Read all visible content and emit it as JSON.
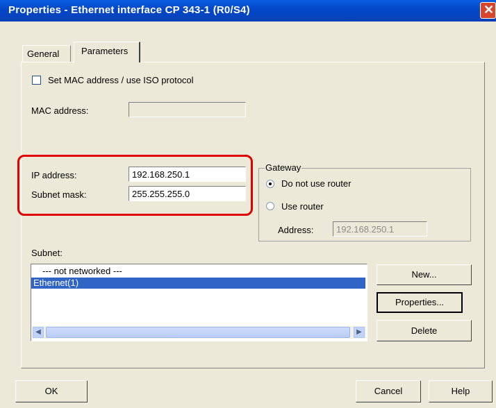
{
  "window": {
    "title": "Properties - Ethernet interface  CP 343-1 (R0/S4)"
  },
  "tabs": [
    {
      "label": "General"
    },
    {
      "label": "Parameters"
    }
  ],
  "mac": {
    "checkbox_label": "Set MAC address / use ISO protocol",
    "checked": false,
    "address_label": "MAC address:",
    "address_value": ""
  },
  "ip": {
    "ip_label": "IP address:",
    "ip_value": "192.168.250.1",
    "subnet_label": "Subnet mask:",
    "subnet_value": "255.255.255.0"
  },
  "gateway": {
    "legend": "Gateway",
    "option_no_router": "Do not use router",
    "option_router": "Use router",
    "selected": "Do not use router",
    "address_label": "Address:",
    "address_value": "192.168.250.1"
  },
  "subnet": {
    "label": "Subnet:",
    "items": [
      {
        "label": "--- not networked ---"
      },
      {
        "label": "Ethernet(1)",
        "selected": true
      }
    ],
    "buttons": {
      "new": "New...",
      "properties": "Properties...",
      "delete": "Delete"
    }
  },
  "footer": {
    "ok": "OK",
    "cancel": "Cancel",
    "help": "Help"
  },
  "colors": {
    "title_bar": "#0548c9",
    "selection": "#3165c5",
    "highlight_box": "#e00000",
    "dialog_bg": "#ece9d8"
  }
}
